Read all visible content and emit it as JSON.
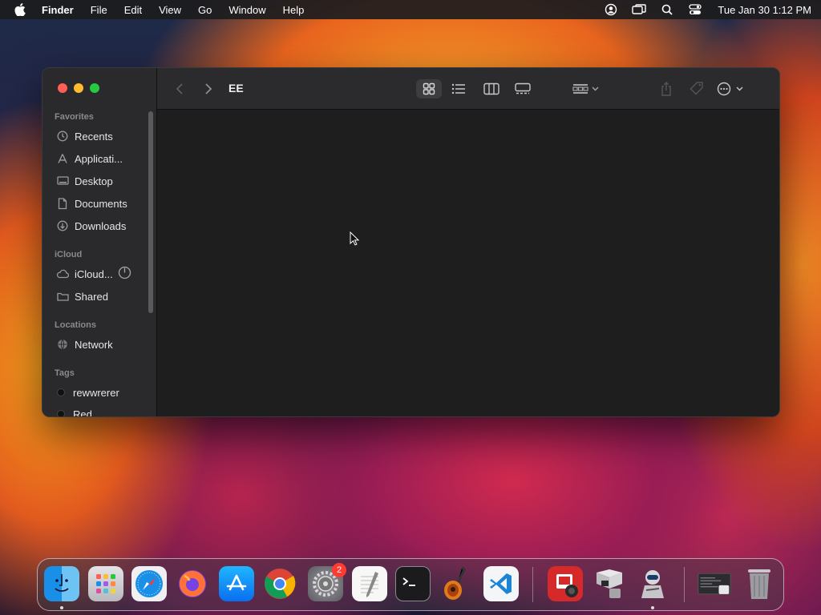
{
  "menubar": {
    "app_name": "Finder",
    "menus": [
      "File",
      "Edit",
      "View",
      "Go",
      "Window",
      "Help"
    ],
    "clock": "Tue Jan 30  1:12 PM",
    "tray_icons": [
      "user-icon",
      "screen-mirroring-icon",
      "search-icon",
      "control-center-icon"
    ]
  },
  "window": {
    "title": "EE",
    "sidebar": {
      "favorites_header": "Favorites",
      "favorites": [
        {
          "label": "Recents",
          "icon": "clock-icon"
        },
        {
          "label": "Applicati...",
          "icon": "applications-icon"
        },
        {
          "label": "Desktop",
          "icon": "desktop-icon"
        },
        {
          "label": "Documents",
          "icon": "document-icon"
        },
        {
          "label": "Downloads",
          "icon": "download-icon"
        }
      ],
      "icloud_header": "iCloud",
      "icloud": [
        {
          "label": "iCloud...",
          "icon": "cloud-icon"
        },
        {
          "label": "Shared",
          "icon": "shared-folder-icon"
        }
      ],
      "locations_header": "Locations",
      "locations": [
        {
          "label": "Network",
          "icon": "globe-icon"
        }
      ],
      "tags_header": "Tags",
      "tags": [
        {
          "label": "rewwrerer"
        },
        {
          "label": "Red"
        }
      ]
    },
    "toolbar": {
      "view_modes": [
        "icon-view",
        "list-view",
        "column-view",
        "gallery-view"
      ],
      "selected_view": "icon-view"
    }
  },
  "dock": {
    "apps": [
      "Finder",
      "Launchpad",
      "Safari",
      "Firefox",
      "App Store",
      "Chrome",
      "System Settings",
      "TextEdit",
      "Terminal",
      "GarageBand",
      "VS Code",
      "Photo Booth",
      "Boot Camp Assistant",
      "Automator",
      "Screenshot",
      "Trash"
    ],
    "settings_badge": "2"
  }
}
